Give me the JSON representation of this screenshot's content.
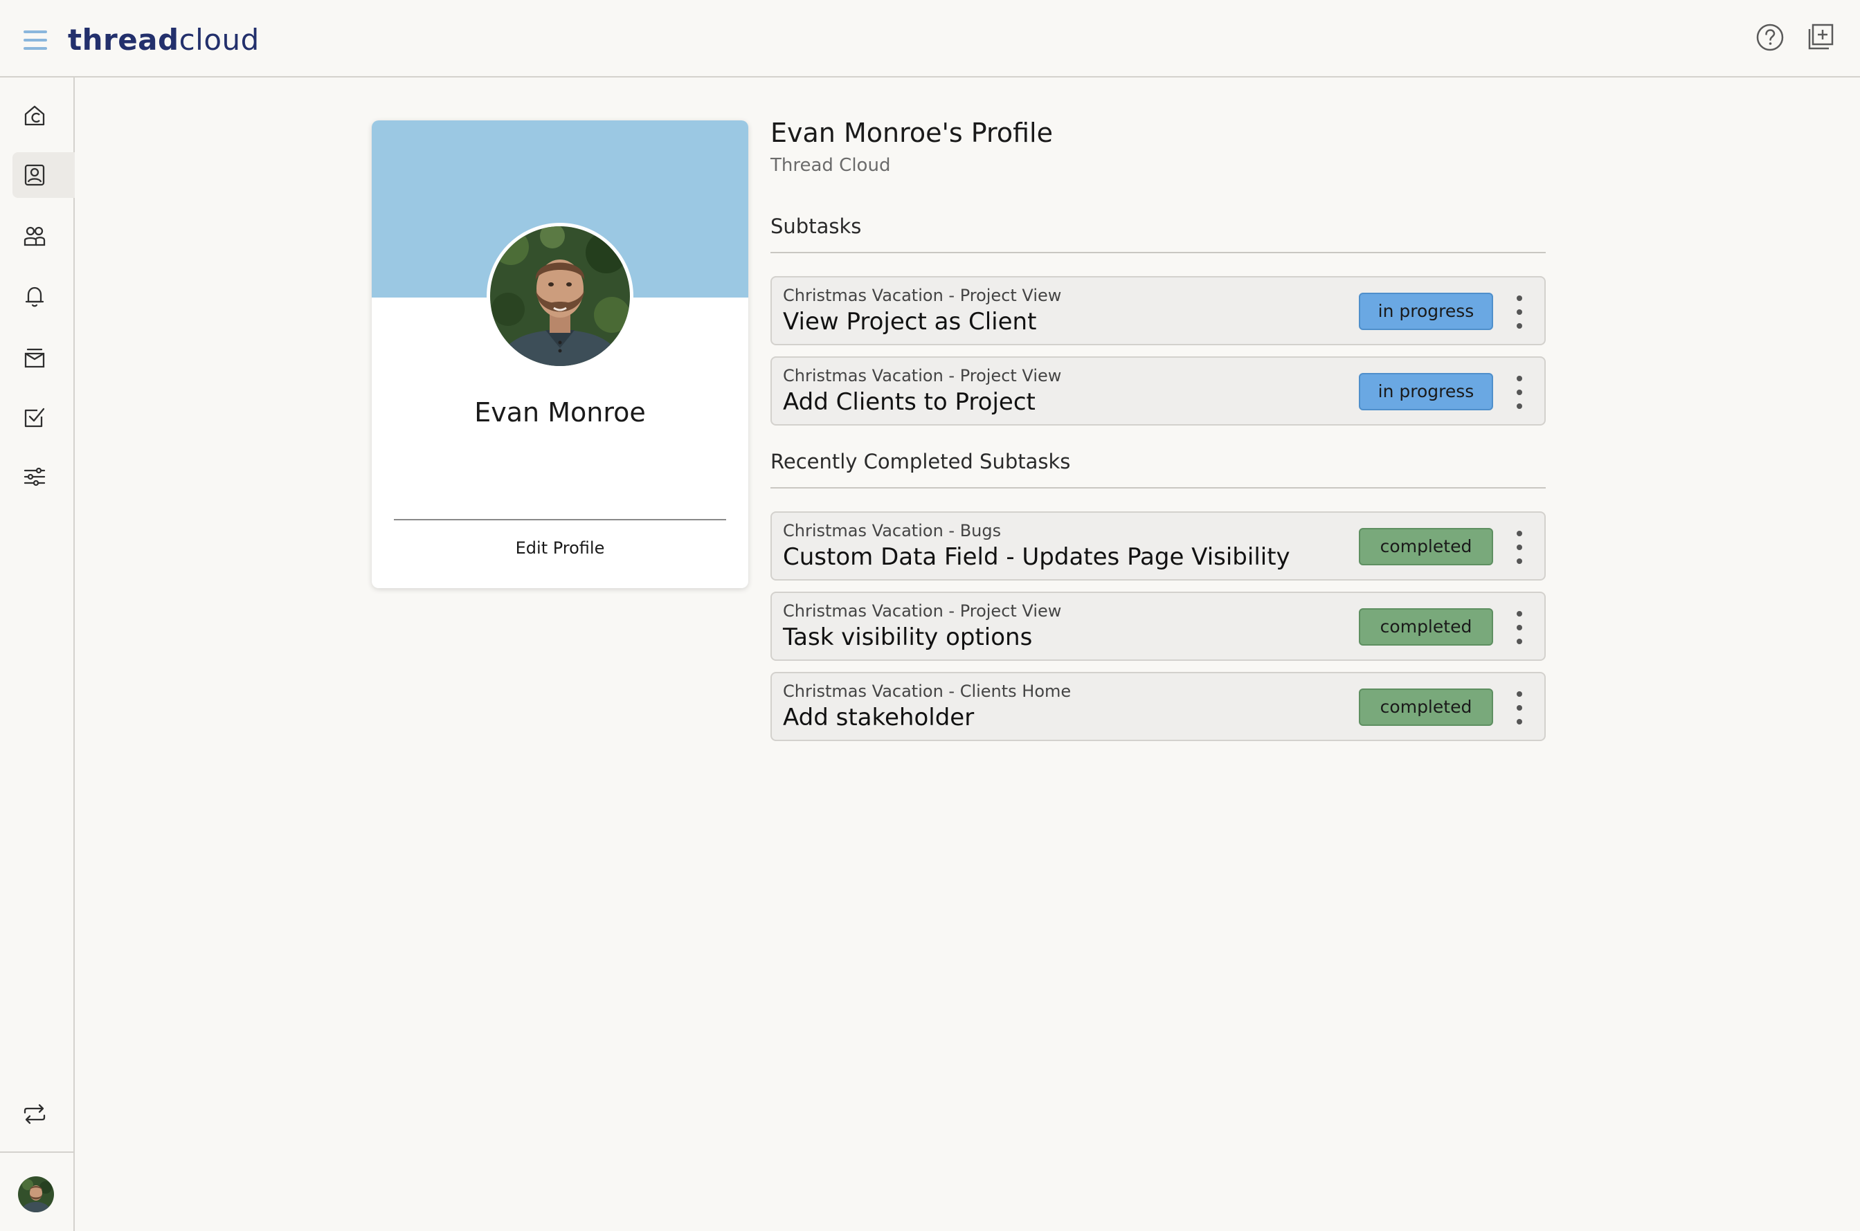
{
  "app": {
    "logo_bold": "thread",
    "logo_light": "cloud"
  },
  "colors": {
    "brand": "#23306c",
    "banner": "#9bc8e3",
    "in_progress": "#6aa8e3",
    "completed": "#79a97b",
    "accent_menu": "#8ab6dc"
  },
  "header": {
    "icons": [
      "help-icon",
      "add-page-icon"
    ]
  },
  "sidebar": {
    "items": [
      {
        "icon": "home-icon",
        "active": false
      },
      {
        "icon": "profile-icon",
        "active": true
      },
      {
        "icon": "clients-icon",
        "active": false
      },
      {
        "icon": "bell-icon",
        "active": false
      },
      {
        "icon": "inbox-icon",
        "active": false
      },
      {
        "icon": "tasks-icon",
        "active": false
      },
      {
        "icon": "settings-sliders-icon",
        "active": false
      }
    ],
    "bottom_icon": "switch-icon",
    "avatar": "user-avatar"
  },
  "profile_card": {
    "name": "Evan Monroe",
    "edit_label": "Edit Profile"
  },
  "profile": {
    "title": "Evan Monroe's Profile",
    "org": "Thread Cloud"
  },
  "subtasks": {
    "heading": "Subtasks",
    "items": [
      {
        "context": "Christmas Vacation - Project View",
        "title": "View Project as Client",
        "status": "in progress"
      },
      {
        "context": "Christmas Vacation - Project View",
        "title": "Add Clients to Project",
        "status": "in progress"
      }
    ]
  },
  "completed": {
    "heading": "Recently Completed Subtasks",
    "items": [
      {
        "context": "Christmas Vacation - Bugs",
        "title": "Custom Data Field - Updates Page Visibility",
        "status": "completed"
      },
      {
        "context": "Christmas Vacation - Project View",
        "title": "Task visibility options",
        "status": "completed"
      },
      {
        "context": "Christmas Vacation - Clients Home",
        "title": "Add stakeholder",
        "status": "completed"
      }
    ]
  }
}
